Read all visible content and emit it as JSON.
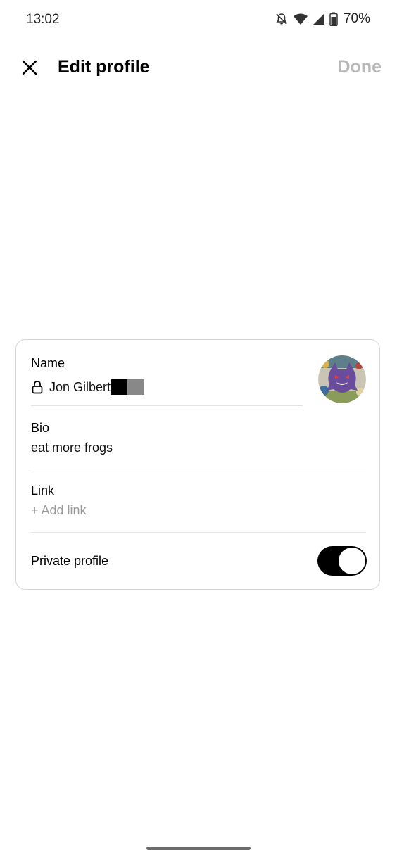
{
  "status_bar": {
    "time": "13:02",
    "battery": "70%",
    "icons": [
      "bell-off-icon",
      "wifi-icon",
      "signal-icon",
      "battery-icon"
    ]
  },
  "header": {
    "title": "Edit profile",
    "done_label": "Done",
    "close_icon": "close-icon"
  },
  "profile": {
    "name_label": "Name",
    "name_value": "Jon Gilbert",
    "bio_label": "Bio",
    "bio_value": "eat more frogs",
    "link_label": "Link",
    "link_placeholder": "+ Add link",
    "private_label": "Private profile",
    "private_enabled": true
  },
  "colors": {
    "done_disabled": "#b8b8b8",
    "toggle_on": "#000000",
    "card_border": "#d6d6d6"
  }
}
